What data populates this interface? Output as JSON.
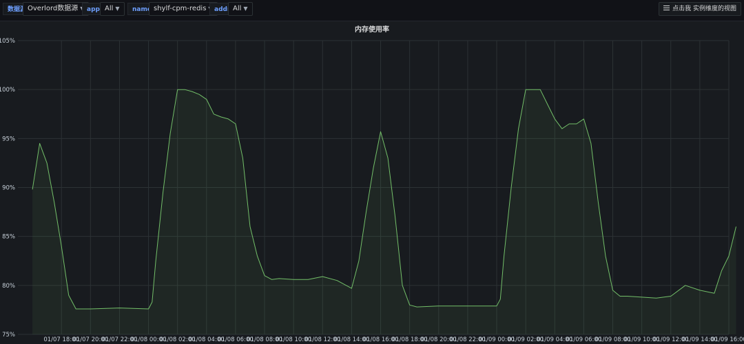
{
  "toolbar": {
    "datasource_label": "数据源",
    "datasource_value": "Overlord数据源",
    "app_label": "app",
    "app_value": "All",
    "name_label": "name",
    "name_value": "shylf-cpm-redis",
    "addr_label": "addr",
    "addr_value": "All",
    "view_link": "点击我 实例维度的视图"
  },
  "panel": {
    "title": "内存使用率"
  },
  "colors": {
    "line": "#73bf69",
    "fill": "#73bf69",
    "grid": "#2c3235",
    "background": "#181b1f"
  },
  "chart_data": {
    "type": "area",
    "title": "内存使用率",
    "xlabel": "",
    "ylabel": "",
    "ylim": [
      75,
      105
    ],
    "yticks": [
      "75%",
      "80%",
      "85%",
      "90%",
      "95%",
      "100%",
      "105%"
    ],
    "ytick_values": [
      75,
      80,
      85,
      90,
      95,
      100,
      105
    ],
    "xlim_hours": [
      15,
      64
    ],
    "xticks": [
      "01/07 18:00",
      "01/07 20:00",
      "01/07 22:00",
      "01/08 00:00",
      "01/08 02:00",
      "01/08 04:00",
      "01/08 06:00",
      "01/08 08:00",
      "01/08 10:00",
      "01/08 12:00",
      "01/08 14:00",
      "01/08 16:00",
      "01/08 18:00",
      "01/08 20:00",
      "01/08 22:00",
      "01/09 00:00",
      "01/09 02:00",
      "01/09 04:00",
      "01/09 06:00",
      "01/09 08:00",
      "01/09 10:00",
      "01/09 12:00",
      "01/09 14:00",
      "01/09 16:00"
    ],
    "grid": true,
    "legend": "none",
    "series": [
      {
        "x": [
          "01/07 16:00",
          "01/07 16:30",
          "01/07 17:00",
          "01/07 17:30",
          "01/07 18:00",
          "01/07 18:30",
          "01/07 19:00",
          "01/07 20:00",
          "01/07 22:00",
          "01/08 00:00",
          "01/08 00:15",
          "01/08 00:30",
          "01/08 01:00",
          "01/08 01:30",
          "01/08 02:00",
          "01/08 02:30",
          "01/08 03:00",
          "01/08 03:30",
          "01/08 04:00",
          "01/08 04:30",
          "01/08 05:00",
          "01/08 05:30",
          "01/08 06:00",
          "01/08 06:30",
          "01/08 07:00",
          "01/08 07:30",
          "01/08 08:00",
          "01/08 08:30",
          "01/08 09:00",
          "01/08 10:00",
          "01/08 11:00",
          "01/08 12:00",
          "01/08 13:00",
          "01/08 14:00",
          "01/08 14:30",
          "01/08 15:00",
          "01/08 15:30",
          "01/08 16:00",
          "01/08 16:30",
          "01/08 17:00",
          "01/08 17:30",
          "01/08 18:00",
          "01/08 18:30",
          "01/08 20:00",
          "01/08 22:00",
          "01/09 00:00",
          "01/09 00:15",
          "01/09 00:30",
          "01/09 01:00",
          "01/09 01:30",
          "01/09 02:00",
          "01/09 02:30",
          "01/09 03:00",
          "01/09 03:30",
          "01/09 04:00",
          "01/09 04:30",
          "01/09 05:00",
          "01/09 05:30",
          "01/09 06:00",
          "01/09 06:30",
          "01/09 07:00",
          "01/09 07:30",
          "01/09 08:00",
          "01/09 08:30",
          "01/09 09:00",
          "01/09 10:00",
          "01/09 11:00",
          "01/09 12:00",
          "01/09 13:00",
          "01/09 14:00",
          "01/09 15:00",
          "01/09 15:30",
          "01/09 16:00",
          "01/09 16:30"
        ],
        "y": [
          89.8,
          94.5,
          92.5,
          88.5,
          84,
          79,
          77.6,
          77.6,
          77.7,
          77.6,
          78.3,
          82.5,
          89.5,
          95.5,
          100,
          100,
          99.8,
          99.5,
          99,
          97.5,
          97.2,
          97,
          96.5,
          93,
          86,
          83,
          81,
          80.6,
          80.7,
          80.6,
          80.6,
          80.9,
          80.5,
          79.7,
          82.5,
          87.5,
          92,
          95.7,
          93,
          87,
          80,
          78,
          77.8,
          77.9,
          77.9,
          77.9,
          78.6,
          83,
          90,
          96,
          100,
          100,
          100,
          98.5,
          97,
          96,
          96.5,
          96.5,
          97,
          94.5,
          88.5,
          83,
          79.5,
          78.9,
          78.9,
          78.8,
          78.7,
          78.9,
          80,
          79.5,
          79.2,
          81.5,
          83,
          86
        ]
      }
    ]
  }
}
